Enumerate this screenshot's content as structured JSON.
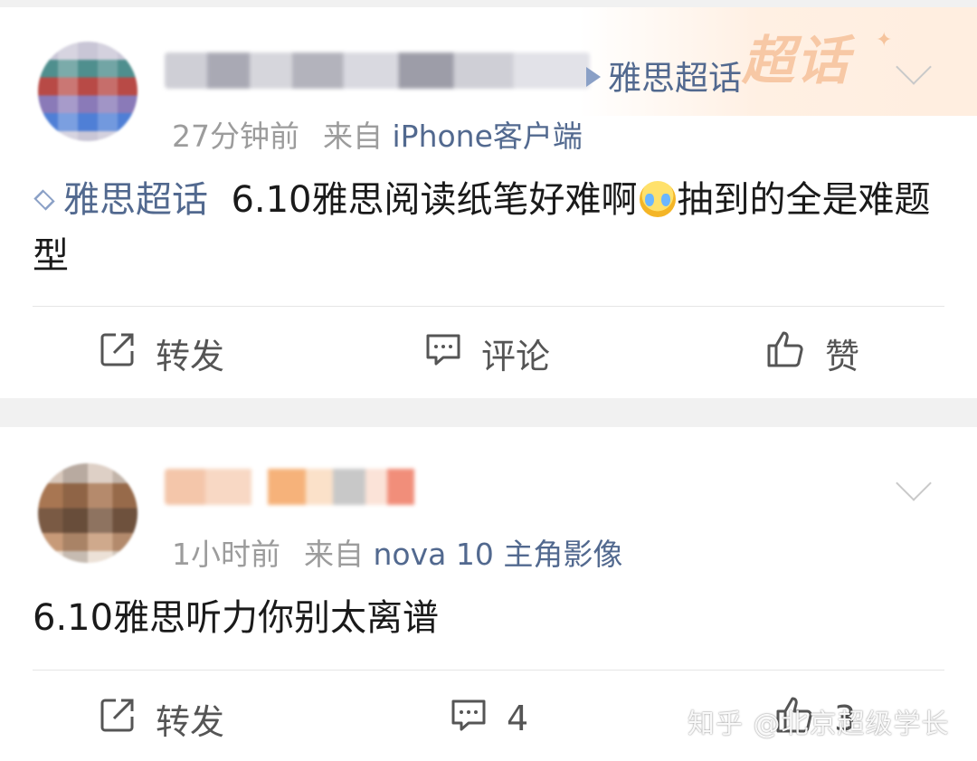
{
  "posts": [
    {
      "topic_tag": "雅思超话",
      "banner_label": "超话",
      "time": "27分钟前",
      "from_label": "来自",
      "source": "iPhone客户端",
      "inline_topic": "雅思超话",
      "text_part1": "6.10雅思阅读纸笔好难啊",
      "text_part2": "抽到的全是难题型",
      "emoji": "crying-face",
      "actions": {
        "repost": "转发",
        "comment": "评论",
        "like": "赞"
      }
    },
    {
      "time": "1小时前",
      "from_label": "来自",
      "source": "nova 10 主角影像",
      "text": "6.10雅思听力你别太离谱",
      "actions": {
        "repost": "转发",
        "comment": "4",
        "like": "3"
      }
    }
  ],
  "watermark": "知乎 @北京超级学长",
  "colors": {
    "link": "#52698f",
    "meta": "#9c9c9c",
    "text": "#1a1a1a",
    "banner": "#f6c29b"
  }
}
